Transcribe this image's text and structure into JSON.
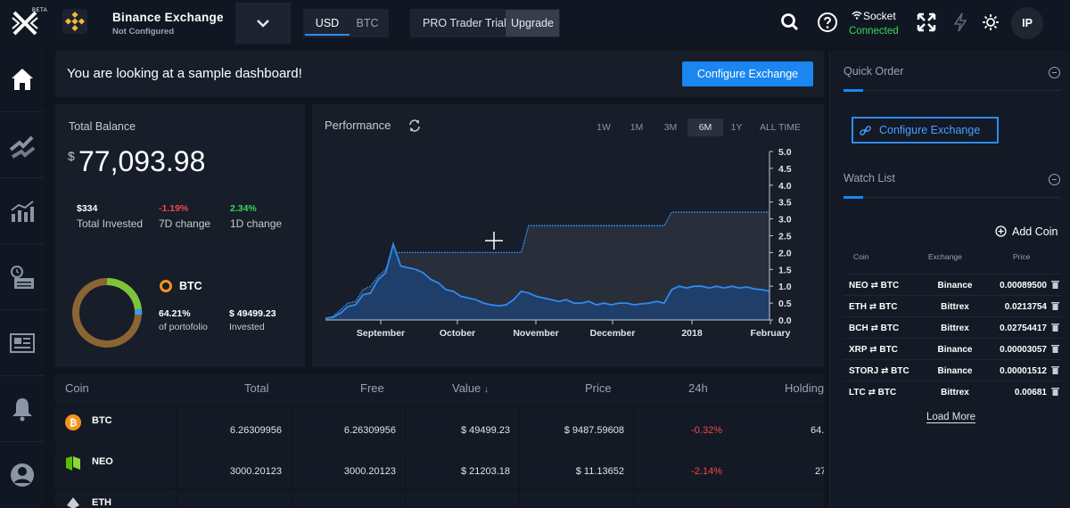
{
  "app": {
    "beta_tag": "BETA"
  },
  "exchange": {
    "name": "Binance Exchange",
    "status": "Not Configured"
  },
  "currency": {
    "options": [
      "USD",
      "BTC"
    ],
    "selected": "USD"
  },
  "pro": {
    "label": "PRO Trader Trial",
    "upgrade": "Upgrade"
  },
  "socket": {
    "label": "Socket",
    "status": "Connected",
    "status_color": "#3ad65b"
  },
  "user": {
    "initials": "IP"
  },
  "sidebar": {
    "items": [
      {
        "icon": "home-icon"
      },
      {
        "icon": "exchange-arrows-icon"
      },
      {
        "icon": "bar-chart-icon"
      },
      {
        "icon": "clock-calendar-icon"
      },
      {
        "icon": "news-icon"
      },
      {
        "icon": "bell-icon"
      },
      {
        "icon": "user-icon"
      }
    ]
  },
  "banner": {
    "text": "You are looking at a sample dashboard!",
    "button": "Configure Exchange"
  },
  "balance": {
    "title": "Total Balance",
    "currency_symbol": "$",
    "amount": "77,093.98",
    "stats": [
      {
        "value": "$334",
        "label": "Total Invested",
        "color": "#ffffff"
      },
      {
        "value": "-1.19%",
        "label": "7D change",
        "color": "#ef4a4a"
      },
      {
        "value": "2.34%",
        "label": "1D change",
        "color": "#3ad65b"
      }
    ],
    "legend": {
      "coin": "BTC",
      "percent": "64.21%",
      "percent_label": "of portofolio",
      "invested": "$ 49499.23",
      "invested_label": "Invested"
    }
  },
  "performance": {
    "title": "Performance",
    "ranges": [
      "1W",
      "1M",
      "3M",
      "6M",
      "1Y",
      "ALL TIME"
    ],
    "selected_range": "6M"
  },
  "chart_data": {
    "type": "area",
    "x_ticks": [
      "September",
      "October",
      "November",
      "December",
      "2018",
      "February"
    ],
    "y_ticks": [
      "5.0",
      "4.5",
      "4.0",
      "3.5",
      "3.0",
      "2.5",
      "2.0",
      "1.5",
      "1.0",
      "0.5",
      "0.0"
    ],
    "ylim": [
      0,
      5
    ],
    "series": [
      {
        "values": [
          0.05,
          0.1,
          0.3,
          0.5,
          0.55,
          0.9,
          1.0,
          1.3,
          1.5,
          2.0,
          2.0,
          2.0,
          2.0,
          2.0,
          2.0,
          2.0,
          2.0,
          2.0,
          2.0,
          2.0,
          2.0,
          2.0,
          2.0,
          2.0,
          2.0,
          2.0,
          2.0,
          2.8,
          2.8,
          2.8,
          2.8,
          2.8,
          2.8,
          2.8,
          2.8,
          2.8,
          2.8,
          2.8,
          2.8,
          2.8,
          2.8,
          2.8,
          2.8,
          2.8,
          2.8,
          2.8,
          3.2,
          3.2,
          3.2,
          3.2,
          3.2,
          3.2,
          3.2,
          3.2,
          3.2,
          3.2,
          3.2,
          3.2,
          3.2,
          3.2
        ]
      },
      {
        "values": [
          0.05,
          0.08,
          0.2,
          0.4,
          0.45,
          0.75,
          0.8,
          1.2,
          1.4,
          2.25,
          1.6,
          1.55,
          1.5,
          1.4,
          1.2,
          1.1,
          0.9,
          0.85,
          0.7,
          0.65,
          0.6,
          0.5,
          0.45,
          0.42,
          0.45,
          0.6,
          0.85,
          0.8,
          0.7,
          0.65,
          0.6,
          0.55,
          0.6,
          0.5,
          0.5,
          0.55,
          0.45,
          0.5,
          0.45,
          0.5,
          0.5,
          0.45,
          0.48,
          0.5,
          0.55,
          0.5,
          0.9,
          1.0,
          0.95,
          1.0,
          1.0,
          0.95,
          1.0,
          0.95,
          1.0,
          0.95,
          0.98,
          0.92,
          0.9,
          0.85
        ]
      }
    ],
    "fill_colors": [
      "#2a2f3c",
      "#1f3f6b"
    ],
    "line_color": "#2f8bf0"
  },
  "table": {
    "columns": [
      "Coin",
      "Total",
      "Free",
      "Value",
      "Price",
      "24h",
      "Holding"
    ],
    "sort_indicator": "↓",
    "rows": [
      {
        "coin": "BTC",
        "total": "6.26309956",
        "free": "6.26309956",
        "value": "$ 49499.23",
        "price": "$ 9487.59608",
        "change": "-0.32%",
        "holding": "64."
      },
      {
        "coin": "NEO",
        "total": "3000.20123",
        "free": "3000.20123",
        "value": "$ 21203.18",
        "price": "$ 11.13652",
        "change": "-2.14%",
        "holding": "27"
      },
      {
        "coin": "ETH",
        "total": "",
        "free": "",
        "value": "",
        "price": "",
        "change": "",
        "holding": ""
      }
    ]
  },
  "quick_order": {
    "title": "Quick Order",
    "button": "Configure Exchange"
  },
  "watch_list": {
    "title": "Watch List",
    "add": "Add Coin",
    "headers": [
      "Coin",
      "Exchange",
      "Price"
    ],
    "rows": [
      {
        "coin": "NEO",
        "base": "BTC",
        "exchange": "Binance",
        "price": "0.00089500"
      },
      {
        "coin": "ETH",
        "base": "BTC",
        "exchange": "Bittrex",
        "price": "0.0213754"
      },
      {
        "coin": "BCH",
        "base": "BTC",
        "exchange": "Bittrex",
        "price": "0.02754417"
      },
      {
        "coin": "XRP",
        "base": "BTC",
        "exchange": "Binance",
        "price": "0.00003057"
      },
      {
        "coin": "STORJ",
        "base": "BTC",
        "exchange": "Binance",
        "price": "0.00001512"
      },
      {
        "coin": "LTC",
        "base": "BTC",
        "exchange": "Bittrex",
        "price": "0.00681"
      }
    ],
    "load_more": "Load More",
    "swap_symbol": "⇄"
  }
}
